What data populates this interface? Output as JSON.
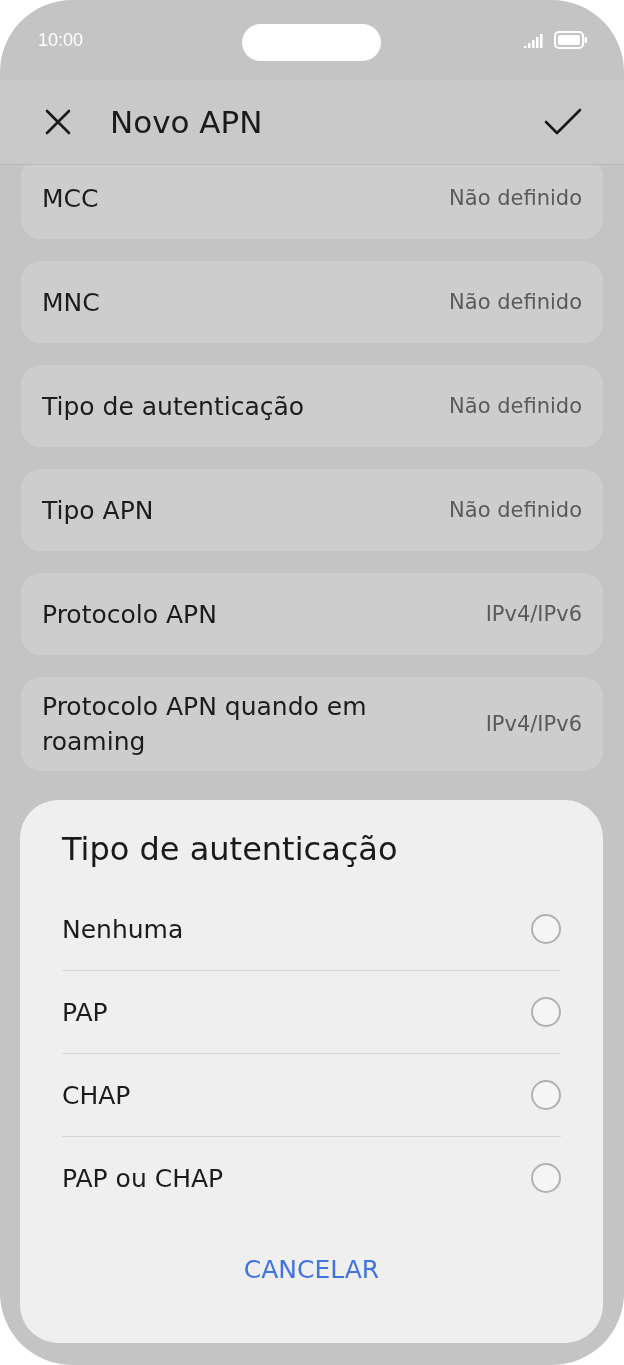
{
  "status_bar": {
    "time": "10:00"
  },
  "header": {
    "title": "Novo APN"
  },
  "settings": [
    {
      "label": "MCC",
      "value": "Não definido"
    },
    {
      "label": "MNC",
      "value": "Não definido"
    },
    {
      "label": "Tipo de autenticação",
      "value": "Não definido"
    },
    {
      "label": "Tipo APN",
      "value": "Não definido"
    },
    {
      "label": "Protocolo APN",
      "value": "IPv4/IPv6"
    },
    {
      "label": "Protocolo APN quando em roaming",
      "value": "IPv4/IPv6"
    }
  ],
  "sheet": {
    "title": "Tipo de autenticação",
    "options": [
      {
        "label": "Nenhuma",
        "selected": false
      },
      {
        "label": "PAP",
        "selected": false
      },
      {
        "label": "CHAP",
        "selected": false
      },
      {
        "label": "PAP ou CHAP",
        "selected": false
      }
    ],
    "cancel": "CANCELAR"
  }
}
